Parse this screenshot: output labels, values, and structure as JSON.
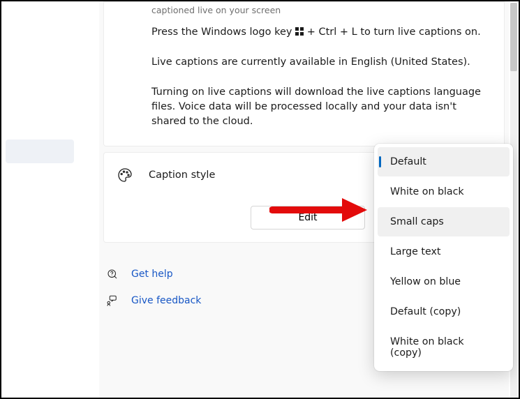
{
  "top_card": {
    "muted": "captioned live on your screen",
    "p1a": "Press the Windows logo key ",
    "p1b": " + Ctrl + L to turn live captions on.",
    "p2": "Live captions are currently available in English (United States).",
    "p3": "Turning on live captions will download the live captions language files. Voice data will be processed locally and your data isn't shared to the cloud."
  },
  "style_card": {
    "label": "Caption style",
    "edit": "Edit"
  },
  "dropdown": {
    "items": [
      "Default",
      "White on black",
      "Small caps",
      "Large text",
      "Yellow on blue",
      "Default (copy)",
      "White on black (copy)"
    ]
  },
  "footer": {
    "help": "Get help",
    "feedback": "Give feedback"
  }
}
